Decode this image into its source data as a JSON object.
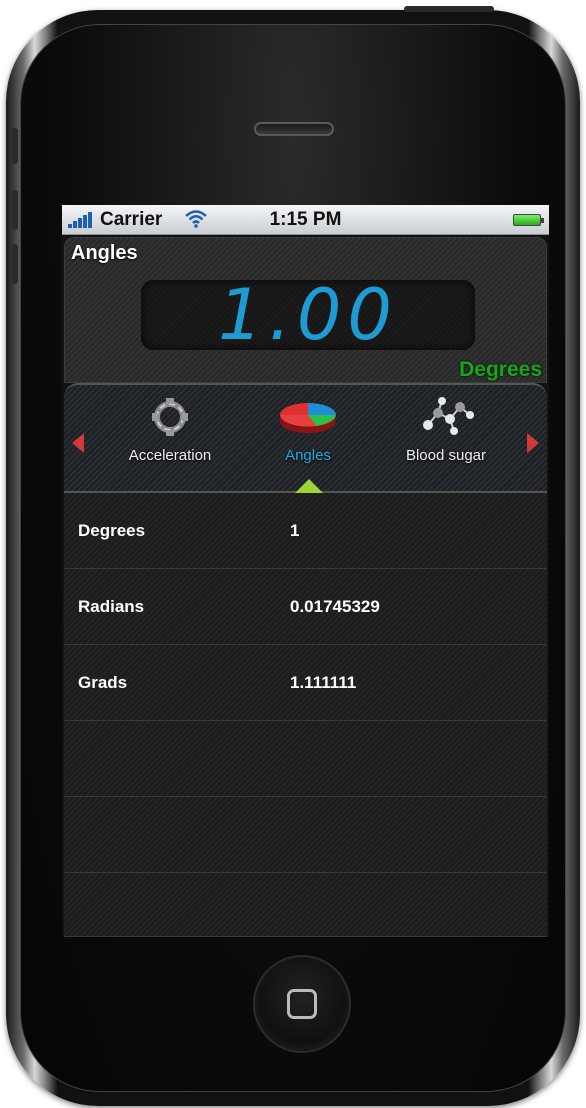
{
  "status_bar": {
    "carrier": "Carrier",
    "time": "1:15 PM",
    "wifi_icon": "wifi-icon",
    "battery_icon": "battery-icon"
  },
  "header": {
    "title": "Angles",
    "display_value": "1.00",
    "unit": "Degrees",
    "value_color": "#1f9bd4",
    "unit_color": "#15a81a"
  },
  "categories": {
    "items": [
      {
        "label": "Acceleration",
        "icon": "acceleration-icon"
      },
      {
        "label": "Angles",
        "icon": "pie-chart-icon",
        "active": true
      },
      {
        "label": "Blood sugar",
        "icon": "molecule-icon"
      }
    ],
    "active_color": "#2aa7e0",
    "indicator_color": "#9ed33a",
    "arrow_color": "#d23a3a"
  },
  "conversions": [
    {
      "unit": "Degrees",
      "value": "1"
    },
    {
      "unit": "Radians",
      "value": "0.01745329"
    },
    {
      "unit": "Grads",
      "value": "1.111111"
    }
  ]
}
